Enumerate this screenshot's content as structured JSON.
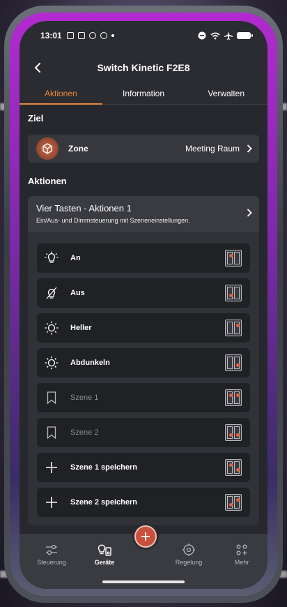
{
  "status_bar": {
    "time": "13:01"
  },
  "header": {
    "title": "Switch Kinetic F2E8"
  },
  "tabs": [
    {
      "label": "Aktionen",
      "active": true
    },
    {
      "label": "Information",
      "active": false
    },
    {
      "label": "Verwalten",
      "active": false
    }
  ],
  "target": {
    "section_title": "Ziel",
    "label": "Zone",
    "value": "Meeting Raum"
  },
  "actions": {
    "section_title": "Aktionen",
    "preset_title": "Vier Tasten - Aktionen 1",
    "preset_subtitle": "Ein/Aus- und Dimmsteuerung mit Szeneneinstellungen.",
    "items": [
      {
        "label": "An",
        "icon": "bulb-on-icon",
        "enabled": true
      },
      {
        "label": "Aus",
        "icon": "bulb-off-icon",
        "enabled": true
      },
      {
        "label": "Heller",
        "icon": "sun-bright-icon",
        "enabled": true
      },
      {
        "label": "Abdunkeln",
        "icon": "sun-dim-icon",
        "enabled": true
      },
      {
        "label": "Szene 1",
        "icon": "bookmark-icon",
        "enabled": false
      },
      {
        "label": "Szene 2",
        "icon": "bookmark-icon",
        "enabled": false
      },
      {
        "label": "Szene 1 speichern",
        "icon": "plus-icon",
        "enabled": true
      },
      {
        "label": "Szene 2 speichern",
        "icon": "plus-icon",
        "enabled": true
      }
    ]
  },
  "bottom_nav": [
    {
      "label": "Steuerung",
      "icon": "sliders-icon",
      "active": false
    },
    {
      "label": "Geräte",
      "icon": "devices-icon",
      "active": true
    },
    {
      "label": "Regelung",
      "icon": "regulation-icon",
      "active": false
    },
    {
      "label": "Mehr",
      "icon": "more-icon",
      "active": false
    }
  ],
  "colors": {
    "accent": "#e7873f",
    "screen_bg": "#27282d",
    "card_bg": "#37383e",
    "row_bg": "#202125",
    "fab": "#c9503d"
  }
}
